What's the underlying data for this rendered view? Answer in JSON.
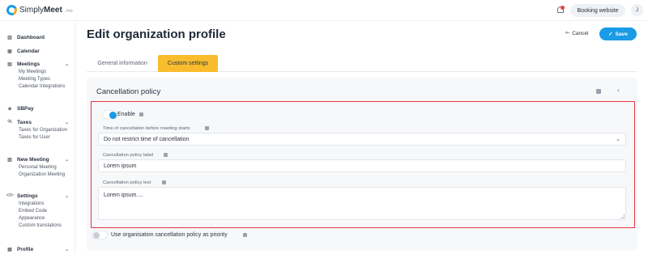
{
  "header": {
    "logo_text_regular": "Simply",
    "logo_text_bold": "Meet",
    "logo_suffix": ".me",
    "booking_button": "Booking website",
    "avatar_initial": "J"
  },
  "sidebar": {
    "groups": [
      {
        "label": "Dashboard",
        "icon": "chart-icon",
        "items": []
      },
      {
        "label": "Calendar",
        "icon": "calendar-icon",
        "items": []
      },
      {
        "label": "Meetings",
        "icon": "meetings-icon",
        "expandable": true,
        "items": [
          "My Meetings",
          "Meeting Types",
          "Calendar Integrations"
        ]
      },
      {
        "label": "SBPay",
        "icon": "pay-icon",
        "items": []
      },
      {
        "label": "Taxes",
        "icon": "percent-icon",
        "expandable": true,
        "items": [
          "Taxes for Organization",
          "Taxes for User"
        ]
      },
      {
        "label": "New Meeting",
        "icon": "new-meeting-icon",
        "expandable": true,
        "items": [
          "Personal Meeting",
          "Organization Meeting"
        ]
      },
      {
        "label": "Settings",
        "icon": "code-icon",
        "expandable": true,
        "items": [
          "Integrations",
          "Embed Code",
          "Appearance",
          "Custom translations"
        ]
      },
      {
        "label": "Profile",
        "icon": "profile-icon",
        "expandable": true,
        "items": []
      }
    ]
  },
  "main": {
    "title": "Edit organization profile",
    "cancel_label": "Cancel",
    "save_label": "Save",
    "tabs": [
      {
        "label": "General information",
        "active": false
      },
      {
        "label": "Custom settings",
        "active": true
      }
    ],
    "panel": {
      "title": "Cancellation policy",
      "enable_label": "Enable",
      "enable_on": true,
      "time_label": "Time of cancellation before meeting starts",
      "time_value": "Do not restrict time of cancellation",
      "policy_label_label": "Cancellation policy label",
      "policy_label_value": "Lorem ipsum",
      "policy_text_label": "Cancellation policy text",
      "policy_text_value": "Lorem ipsum....",
      "priority_label": "Use organisation cancellation policy as priority",
      "priority_on": false
    }
  },
  "colors": {
    "accent": "#1a9be6",
    "tab_active": "#f9bc2d",
    "highlight_border": "#e0393e",
    "notification": "#e8413d"
  }
}
